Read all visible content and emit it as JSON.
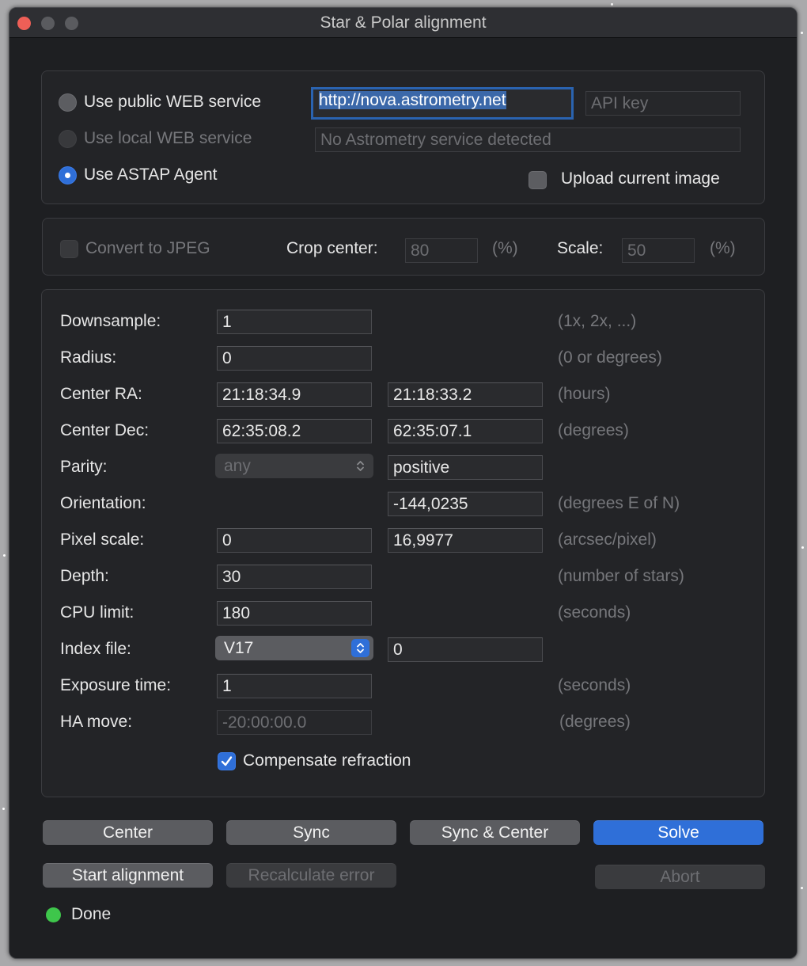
{
  "window": {
    "title": "Star & Polar alignment"
  },
  "service": {
    "public_label": "Use public WEB service",
    "local_label": "Use local WEB service",
    "astap_label": "Use ASTAP Agent",
    "url_value": "http://nova.astrometry.net",
    "api_key_placeholder": "API key",
    "local_status": "No Astrometry service detected",
    "upload_label": "Upload current image",
    "selected": "Use ASTAP Agent"
  },
  "jpeg": {
    "convert_label": "Convert to JPEG",
    "crop_label": "Crop center:",
    "crop_value": "80",
    "crop_unit": "(%)",
    "scale_label": "Scale:",
    "scale_value": "50",
    "scale_unit": "(%)"
  },
  "params": {
    "downsample": {
      "label": "Downsample:",
      "value": "1",
      "hint": "(1x, 2x, ...)"
    },
    "radius": {
      "label": "Radius:",
      "value": "0",
      "hint": "(0 or degrees)"
    },
    "center_ra": {
      "label": "Center RA:",
      "value": "21:18:34.9",
      "result": "21:18:33.2",
      "hint": "(hours)"
    },
    "center_dec": {
      "label": "Center Dec:",
      "value": "62:35:08.2",
      "result": "62:35:07.1",
      "hint": "(degrees)"
    },
    "parity": {
      "label": "Parity:",
      "value": "any",
      "result": "positive"
    },
    "orientation": {
      "label": "Orientation:",
      "result": "-144,0235",
      "hint": "(degrees E of N)"
    },
    "pixel_scale": {
      "label": "Pixel scale:",
      "value": "0",
      "result": "16,9977",
      "hint": "(arcsec/pixel)"
    },
    "depth": {
      "label": "Depth:",
      "value": "30",
      "hint": "(number of stars)"
    },
    "cpu_limit": {
      "label": "CPU limit:",
      "value": "180",
      "hint": "(seconds)"
    },
    "index_file": {
      "label": "Index file:",
      "value": "V17",
      "result": "0"
    },
    "exposure": {
      "label": "Exposure time:",
      "value": "1",
      "hint": "(seconds)"
    },
    "ha_move": {
      "label": "HA move:",
      "value": "-20:00:00.0",
      "hint": "(degrees)"
    },
    "refraction_label": "Compensate refraction"
  },
  "buttons": {
    "center": "Center",
    "sync": "Sync",
    "sync_center": "Sync & Center",
    "solve": "Solve",
    "start_alignment": "Start alignment",
    "recalculate": "Recalculate error",
    "abort": "Abort"
  },
  "status": {
    "text": "Done",
    "color": "#3ec64b"
  },
  "colors": {
    "accent": "#2f6fd8",
    "close": "#ee5f57"
  }
}
